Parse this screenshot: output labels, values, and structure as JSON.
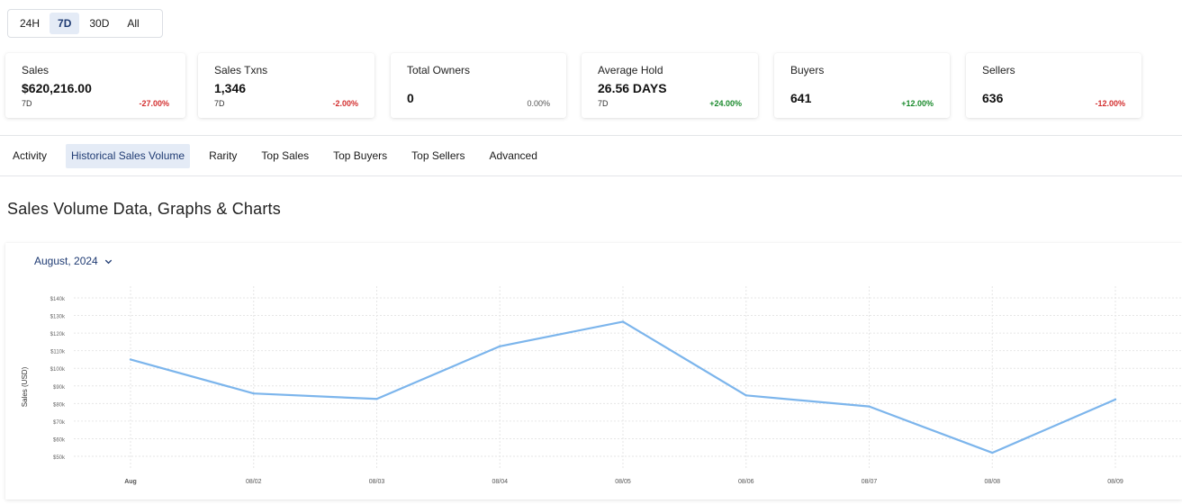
{
  "range": {
    "options": [
      "24H",
      "7D",
      "30D",
      "All"
    ],
    "selected": "7D"
  },
  "stats": [
    {
      "label": "Sales",
      "value": "$620,216.00",
      "sub": "7D",
      "change": "-27.00%",
      "trend": "neg"
    },
    {
      "label": "Sales Txns",
      "value": "1,346",
      "sub": "7D",
      "change": "-2.00%",
      "trend": "neg"
    },
    {
      "label": "Total Owners",
      "value": "0",
      "sub": "",
      "change": "0.00%",
      "trend": "neu"
    },
    {
      "label": "Average Hold",
      "value": "26.56 DAYS",
      "sub": "7D",
      "change": "+24.00%",
      "trend": "pos"
    },
    {
      "label": "Buyers",
      "value": "641",
      "sub": "",
      "change": "+12.00%",
      "trend": "pos"
    },
    {
      "label": "Sellers",
      "value": "636",
      "sub": "",
      "change": "-12.00%",
      "trend": "neg"
    }
  ],
  "tabs": [
    "Activity",
    "Historical Sales Volume",
    "Rarity",
    "Top Sales",
    "Top Buyers",
    "Top Sellers",
    "Advanced"
  ],
  "active_tab": "Historical Sales Volume",
  "section_title": "Sales Volume Data, Graphs & Charts",
  "month_selector": {
    "label": "August, 2024",
    "icon": "chevron-down-icon"
  },
  "colors": {
    "line": "#7cb5ec",
    "accent": "#1f3b73",
    "negative": "#d32f2f",
    "positive": "#1a8a2c"
  },
  "chart_data": {
    "type": "line",
    "categories": [
      "Aug",
      "08/02",
      "08/03",
      "08/04",
      "08/05",
      "08/06",
      "08/07",
      "08/08",
      "08/09"
    ],
    "series": [
      {
        "values": [
          105000,
          85700,
          82600,
          112500,
          126500,
          84600,
          78300,
          52000,
          82300
        ]
      }
    ],
    "ylabel": "Sales (USD)",
    "y_ticks": [
      50000,
      60000,
      70000,
      80000,
      90000,
      100000,
      110000,
      120000,
      130000,
      140000
    ],
    "y_tick_labels": [
      "$50k",
      "$60k",
      "$70k",
      "$80k",
      "$90k",
      "$100k",
      "$110k",
      "$120k",
      "$130k",
      "$140k"
    ],
    "ylim": [
      50000,
      140000
    ],
    "grid": true
  }
}
